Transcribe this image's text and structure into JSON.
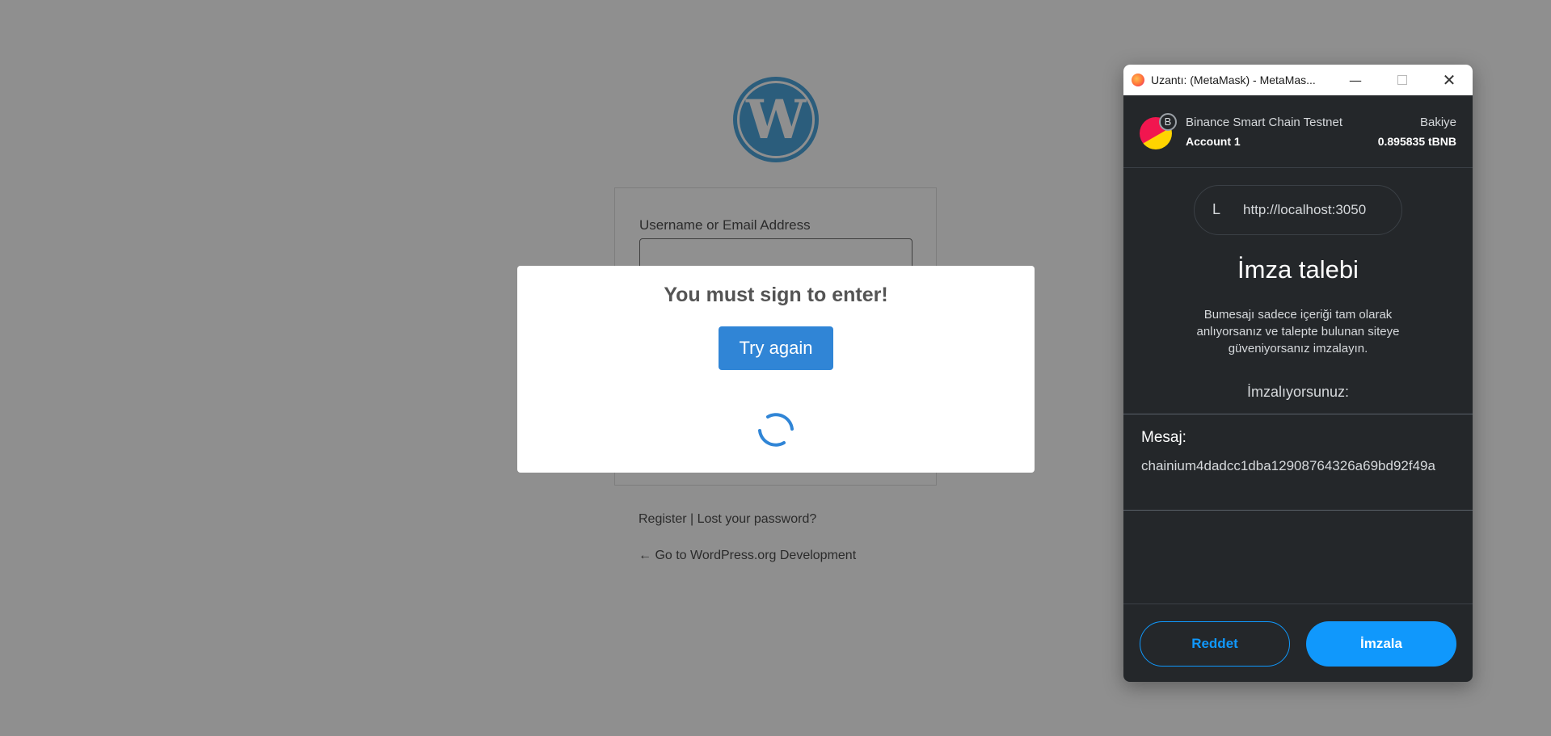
{
  "wordpress": {
    "logo_icon": "wordpress-logo-icon",
    "logo_letter": "W",
    "username_label": "Username or Email Address",
    "username_value": "",
    "register_link": "Register",
    "separator": " | ",
    "lost_password_link": "Lost your password?",
    "back_link": "← Go to WordPress.org Development"
  },
  "sign_modal": {
    "title": "You must sign to enter!",
    "try_again_label": "Try again",
    "spinner_icon": "loading-spinner-icon",
    "accent_color": "#3085d6"
  },
  "metamask": {
    "window_title": "Uzantı: (MetaMask) - MetaMas...",
    "browser_icon": "firefox-icon",
    "window_controls": {
      "minimize_icon": "minimize-icon",
      "minimize_glyph": "—",
      "maximize_icon": "maximize-icon",
      "close_icon": "close-icon",
      "close_glyph": "✕"
    },
    "network_name": "Binance Smart Chain Testnet",
    "network_badge": "B",
    "account_name": "Account 1",
    "balance_label": "Bakiye",
    "balance_value": "0.895835 tBNB",
    "origin_letter": "L",
    "origin_url": "http://localhost:3050",
    "request_title": "İmza talebi",
    "request_description": "Bumesajı sadece içeriği tam olarak anlıyorsanız ve talepte bulunan siteye güveniyorsanız imzalayın.",
    "signing_label": "İmzalıyorsunuz:",
    "message_label": "Mesaj:",
    "message_text": "chainium4dadcc1dba12908764326a69bd92f49a",
    "reject_label": "Reddet",
    "sign_label": "İmzala",
    "accent_color": "#1098fc",
    "background_color": "#24272a"
  }
}
